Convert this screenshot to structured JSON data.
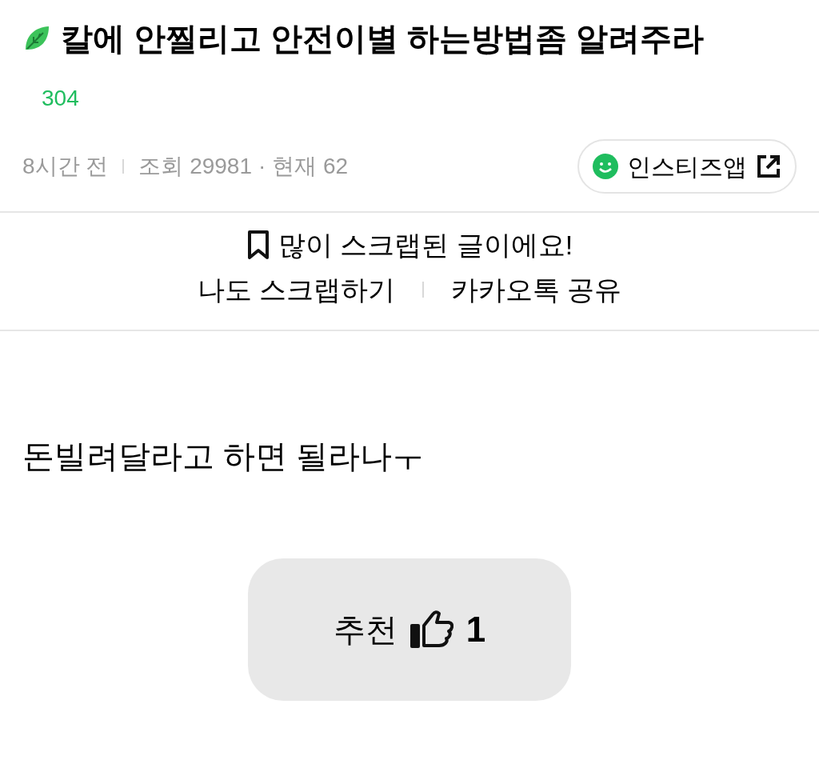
{
  "title": "칼에 안찔리고 안전이별 하는방법좀 알려주라",
  "comment_count": "304",
  "meta": {
    "time": "8시간 전",
    "views": "조회 29981",
    "current": "· 현재 62"
  },
  "app_button": "인스티즈앱",
  "scrap_notice": "많이 스크랩된 글이에요!",
  "actions": [
    "나도 스크랩하기",
    "카카오톡 공유"
  ],
  "body": "돈빌려달라고 하면 될라나ㅜ",
  "recommend": {
    "label": "추천",
    "count": "1"
  }
}
